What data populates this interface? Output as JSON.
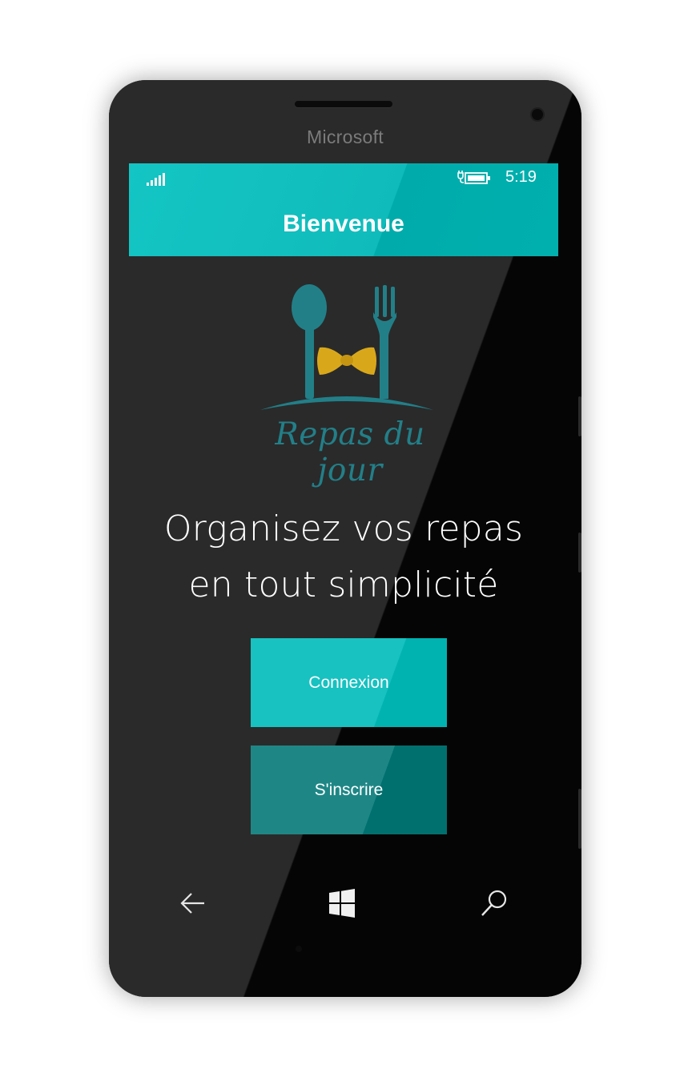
{
  "device": {
    "brand": "Microsoft"
  },
  "status_bar": {
    "time": "5:19",
    "signal_icon": "signal-bars-icon",
    "battery_icon": "battery-charging-icon"
  },
  "app_bar": {
    "title": "Bienvenue",
    "color": "#13c5c4"
  },
  "logo": {
    "text": "Repas du jour",
    "utensil_color": "#227f88",
    "bowtie_color": "#d9a81a"
  },
  "headline": {
    "line1": "Organisez vos repas",
    "line2": "en tout simplicité"
  },
  "buttons": {
    "login_label": "Connexion",
    "signup_label": "S'inscrire",
    "login_color": "#17c2c1",
    "signup_color": "#1e8786"
  },
  "nav": {
    "back_icon": "back-arrow-icon",
    "start_icon": "windows-logo-icon",
    "search_icon": "search-icon"
  }
}
